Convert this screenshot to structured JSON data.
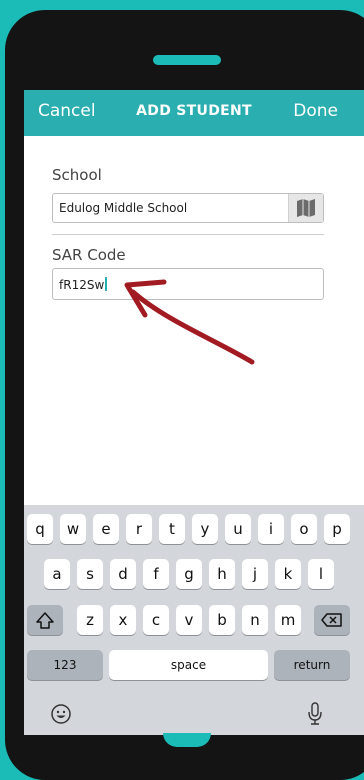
{
  "navbar": {
    "cancel": "Cancel",
    "title": "ADD STUDENT",
    "done": "Done"
  },
  "school": {
    "label": "School",
    "value": "Edulog Middle School",
    "icon": "map-icon"
  },
  "sar": {
    "label": "SAR Code",
    "value": "fR12Sw"
  },
  "keyboard": {
    "row1": [
      "q",
      "w",
      "e",
      "r",
      "t",
      "y",
      "u",
      "i",
      "o",
      "p"
    ],
    "row2": [
      "a",
      "s",
      "d",
      "f",
      "g",
      "h",
      "j",
      "k",
      "l"
    ],
    "row3": [
      "z",
      "x",
      "c",
      "v",
      "b",
      "n",
      "m"
    ],
    "numbers": "123",
    "space": "space",
    "return": "return",
    "shift_icon": "shift-icon",
    "delete_icon": "backspace-icon",
    "emoji_icon": "emoji-icon",
    "mic_icon": "microphone-icon"
  },
  "colors": {
    "accent": "#2aaeb0",
    "background": "#1bbcb8",
    "arrow": "#a31b22"
  }
}
